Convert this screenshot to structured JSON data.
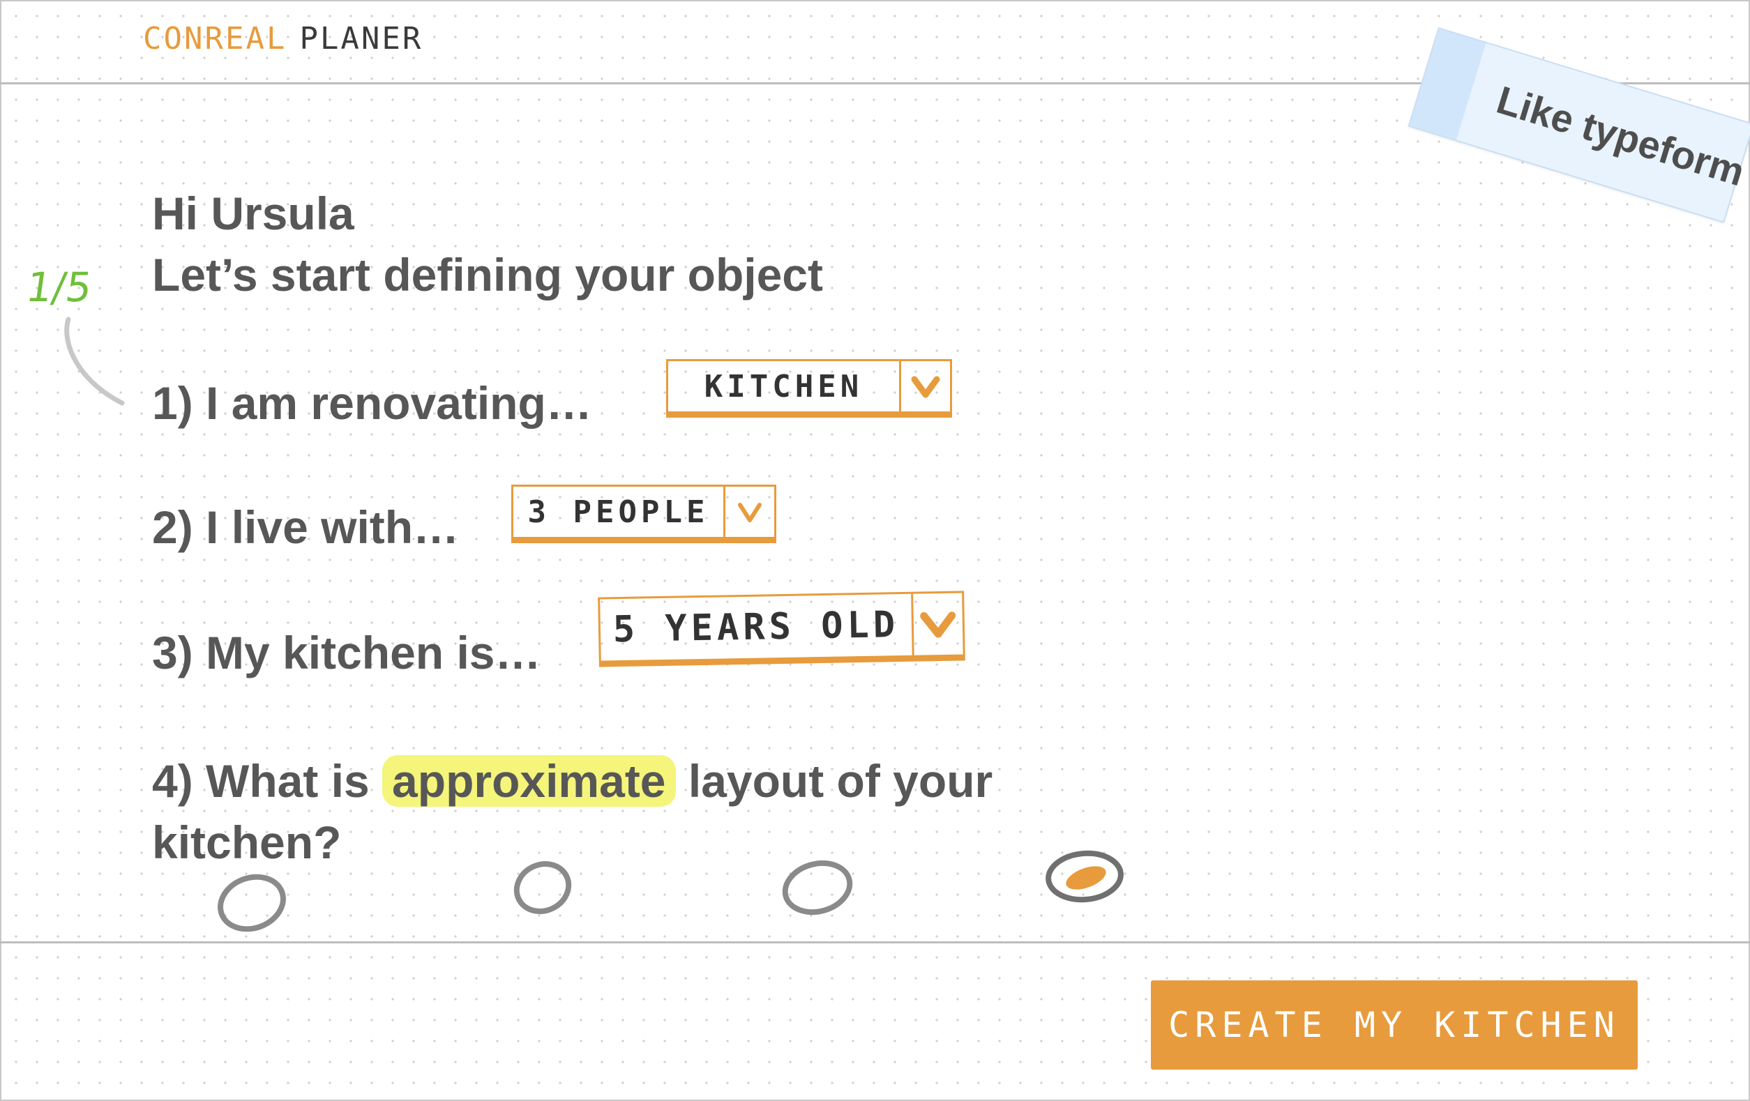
{
  "header": {
    "logo_part1": "CONREAL",
    "logo_part2": "PLANER"
  },
  "sticky_note": {
    "text": "Like typeform"
  },
  "progress": {
    "label": "1/5",
    "current": 1,
    "total": 5
  },
  "greeting": {
    "line1": "Hi Ursula",
    "line2": "Let’s start defining your object"
  },
  "questions": [
    {
      "prompt": "1) I am renovating…",
      "selected": "KITCHEN"
    },
    {
      "prompt": "2) I live with…",
      "selected": "3 PEOPLE"
    },
    {
      "prompt": "3) My kitchen is…",
      "selected": "5 YEARS OLD"
    },
    {
      "prompt_before": "4) What is",
      "prompt_highlight": "approximate",
      "prompt_after": "layout of your kitchen?",
      "options_count": 4,
      "selected_option": 4
    }
  ],
  "cta": {
    "label": "CREATE MY KITCHEN"
  },
  "colors": {
    "accent": "#e79b3c",
    "text": "#575757",
    "progress": "#6fbf3a",
    "highlight": "#f4f57a",
    "sticky": "#e9f3fd"
  }
}
